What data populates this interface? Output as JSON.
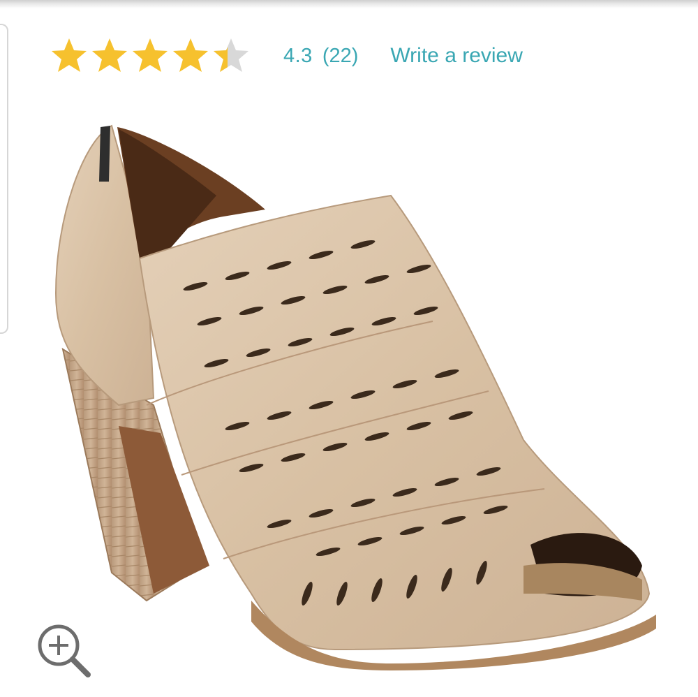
{
  "rating": {
    "value": "4.3",
    "count": "(22)",
    "stars_filled": 4.3,
    "stars_total": 5,
    "star_color": "#f6c12e",
    "star_empty_color": "#d8d8d8",
    "write_review_label": "Write a review",
    "link_color": "#3aa7b3"
  },
  "product": {
    "image_icon": "peep-toe-bootie-image",
    "leather_color": "#d9c2a6",
    "heel_color": "#c8ab8e"
  },
  "zoom": {
    "icon": "zoom-in-icon"
  }
}
